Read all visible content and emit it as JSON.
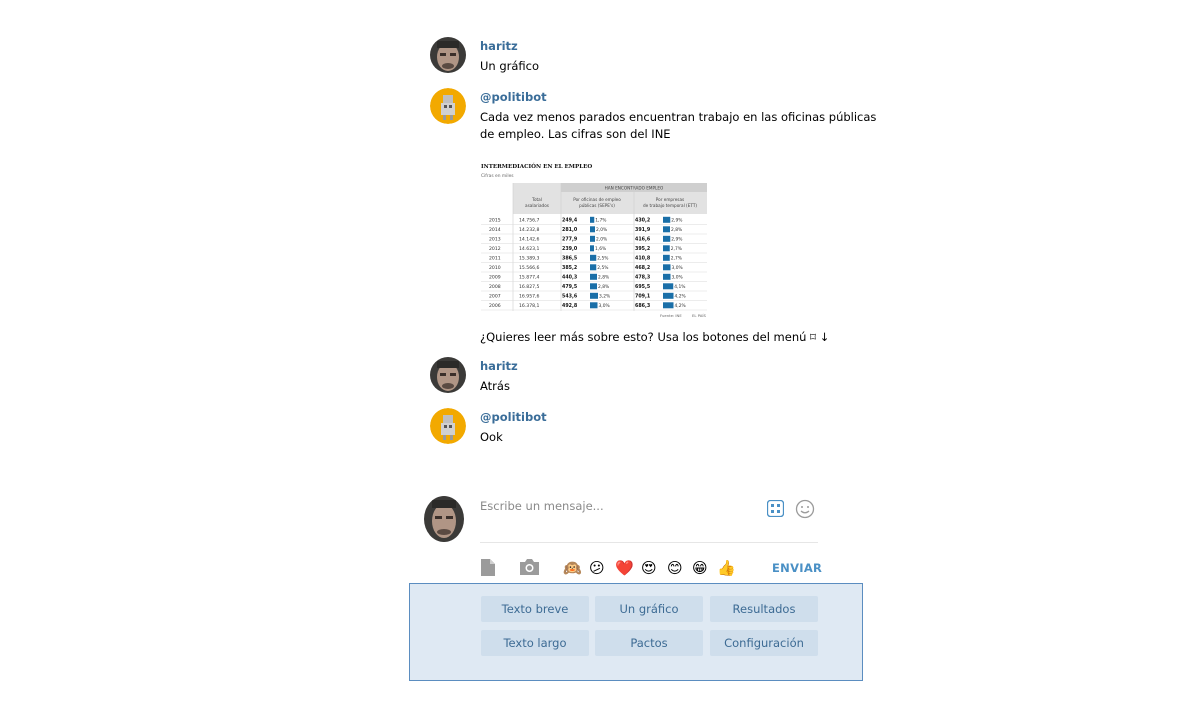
{
  "messages": [
    {
      "author": "haritz",
      "lines": [
        "Un gráfico"
      ]
    },
    {
      "author": "@politibot",
      "lines": [
        "Cada vez menos parados encuentran trabajo en las oficinas públicas",
        "de empleo. Las cifras son del INE"
      ]
    },
    {
      "caption": "¿Quieres leer más sobre esto? Usa los botones del menú ⌑ ↓"
    },
    {
      "author": "haritz",
      "lines": [
        "Atrás"
      ]
    },
    {
      "author": "@politibot",
      "lines": [
        "Ook"
      ]
    }
  ],
  "chart_data": {
    "type": "table",
    "title": "INTERMEDIACIÓN EN EL EMPLEO",
    "subtitle": "Cifras en miles",
    "group_header": "HAN ENCONTRADO EMPLEO",
    "columns": [
      "",
      "Total asalariados",
      "Por oficinas de empleo públicas (SEPE's)",
      "Por empresas de trabajo temporal (ETT)"
    ],
    "col2_l1": "Total",
    "col2_l2": "asalariados",
    "col3_l1": "Por oficinas de empleo",
    "col3_l2": "públicas (SEPE's)",
    "col4_l1": "Por empresas",
    "col4_l2": "de trabajo temporal (ETT)",
    "rows": [
      {
        "year": "2015",
        "total": "14.756,7",
        "sepe": "249,4",
        "sepe_pct": "1,7%",
        "sepe_v": 1.7,
        "ett": "430,2",
        "ett_pct": "2,9%",
        "ett_v": 2.9
      },
      {
        "year": "2014",
        "total": "14.232,8",
        "sepe": "281,0",
        "sepe_pct": "2,0%",
        "sepe_v": 2.0,
        "ett": "391,9",
        "ett_pct": "2,8%",
        "ett_v": 2.8
      },
      {
        "year": "2013",
        "total": "14.142,6",
        "sepe": "277,9",
        "sepe_pct": "2,0%",
        "sepe_v": 2.0,
        "ett": "416,6",
        "ett_pct": "2,9%",
        "ett_v": 2.9
      },
      {
        "year": "2012",
        "total": "14.623,1",
        "sepe": "239,0",
        "sepe_pct": "1,6%",
        "sepe_v": 1.6,
        "ett": "395,2",
        "ett_pct": "2,7%",
        "ett_v": 2.7
      },
      {
        "year": "2011",
        "total": "15.389,3",
        "sepe": "386,5",
        "sepe_pct": "2,5%",
        "sepe_v": 2.5,
        "ett": "410,8",
        "ett_pct": "2,7%",
        "ett_v": 2.7
      },
      {
        "year": "2010",
        "total": "15.566,6",
        "sepe": "385,2",
        "sepe_pct": "2,5%",
        "sepe_v": 2.5,
        "ett": "468,2",
        "ett_pct": "3,0%",
        "ett_v": 3.0
      },
      {
        "year": "2009",
        "total": "15.877,4",
        "sepe": "440,3",
        "sepe_pct": "2,8%",
        "sepe_v": 2.8,
        "ett": "478,3",
        "ett_pct": "3,0%",
        "ett_v": 3.0
      },
      {
        "year": "2008",
        "total": "16.827,5",
        "sepe": "479,5",
        "sepe_pct": "2,8%",
        "sepe_v": 2.8,
        "ett": "695,5",
        "ett_pct": "4,1%",
        "ett_v": 4.1
      },
      {
        "year": "2007",
        "total": "16.957,6",
        "sepe": "543,6",
        "sepe_pct": "3,2%",
        "sepe_v": 3.2,
        "ett": "709,1",
        "ett_pct": "4,2%",
        "ett_v": 4.2
      },
      {
        "year": "2006",
        "total": "16.378,1",
        "sepe": "492,8",
        "sepe_pct": "3,0%",
        "sepe_v": 3.0,
        "ett": "686,3",
        "ett_pct": "4,2%",
        "ett_v": 4.2
      }
    ],
    "source": "Fuente: INE",
    "credit": "EL PAÍS",
    "bar_color": "#1a6fa8"
  },
  "composer": {
    "placeholder": "Escribe un mensaje...",
    "send_label": "ENVIAR",
    "emojis": [
      "🙉",
      "😕",
      "❤️",
      "😍",
      "😊",
      "😁",
      "👍"
    ]
  },
  "keyboard": {
    "buttons": [
      "Texto breve",
      "Un gráfico",
      "Resultados",
      "Texto largo",
      "Pactos",
      "Configuración"
    ]
  },
  "colors": {
    "name": "#3a6d99",
    "send": "#4a90c5",
    "keyboard_bg": "#dfe9f3",
    "keyboard_border": "#5b8dc0",
    "button_bg": "#cfdeec",
    "button_text": "#3d6b94"
  }
}
